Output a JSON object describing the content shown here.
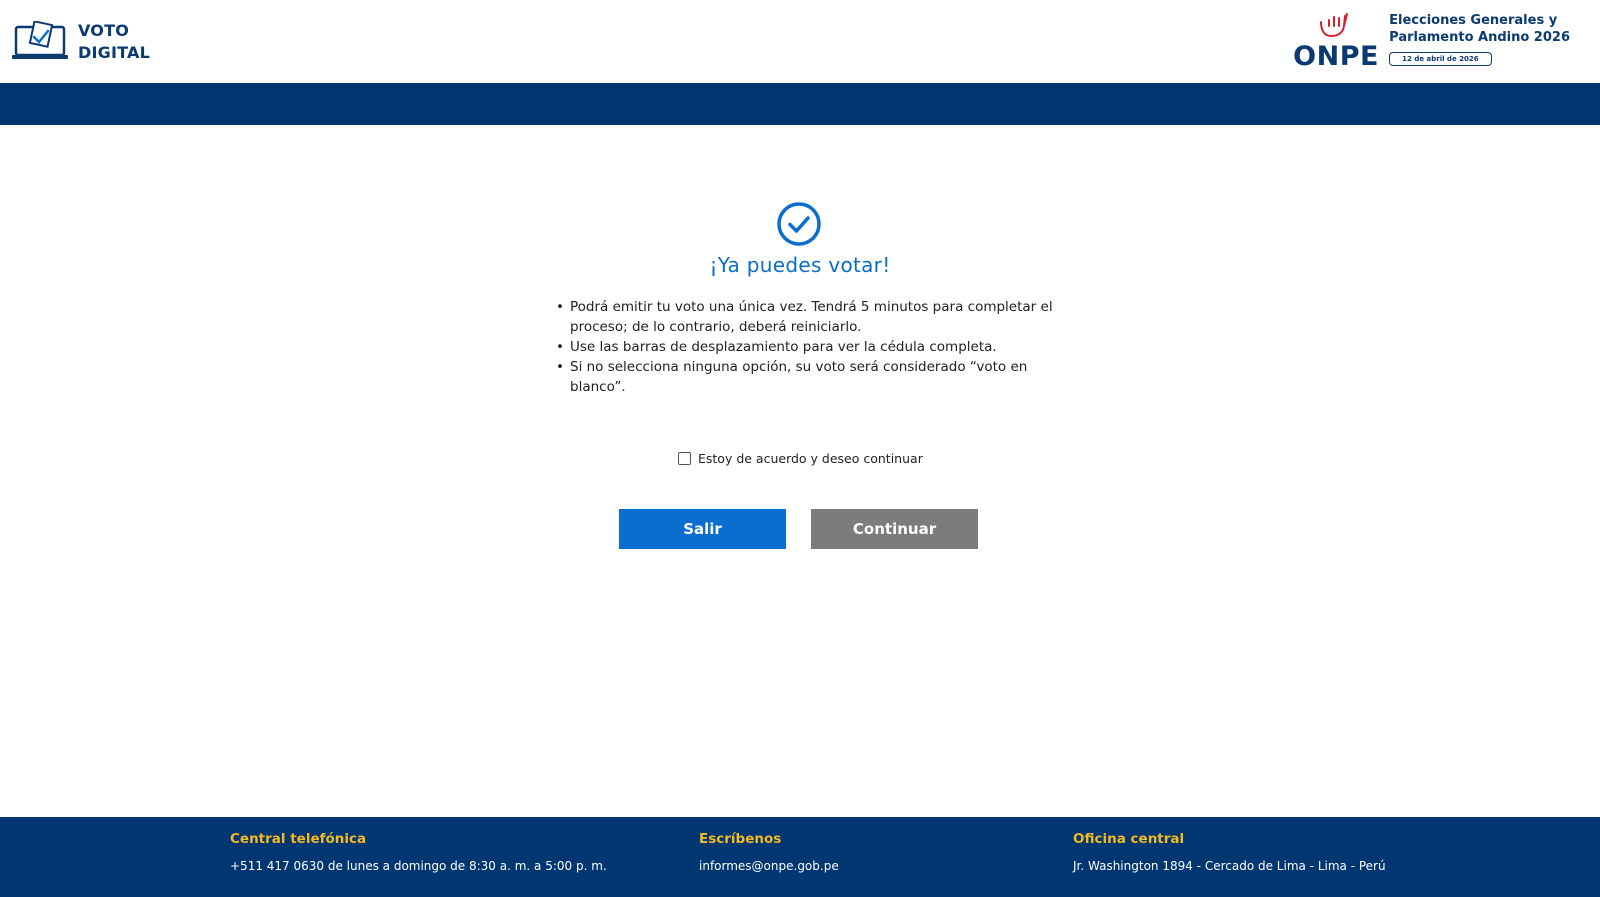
{
  "header": {
    "brand_line1": "VOTO",
    "brand_line2": "DIGITAL",
    "onpe": "ONPE",
    "election_line1": "Elecciones Generales y",
    "election_line2": "Parlamento Andino 2026",
    "election_date": "12 de abril de 2026"
  },
  "main": {
    "title": "¡Ya puedes votar!",
    "rules": [
      "Podrá emitir tu voto una única vez. Tendrá 5 minutos para completar el proceso; de lo contrario, deberá reiniciarlo.",
      "Use las barras de desplazamiento para ver la cédula completa.",
      "Si no selecciona ninguna opción, su voto será considerado “voto en blanco”."
    ],
    "agree_label": "Estoy de acuerdo y deseo continuar",
    "agree_checked": false,
    "exit_button": "Salir",
    "continue_button": "Continuar"
  },
  "footer": {
    "phone_heading": "Central telefónica",
    "phone_text": "+511 417 0630 de lunes a domingo de 8:30 a. m. a 5:00 p. m.",
    "write_heading": "Escríbenos",
    "write_text": "informes@onpe.gob.pe",
    "office_heading": "Oficina central",
    "office_text": "Jr. Washington 1894 - Cercado de Lima - Lima - Perú"
  },
  "colors": {
    "navy": "#003672",
    "primary_blue": "#0a6ed1",
    "disabled_gray": "#7c7c7c",
    "footer_heading": "#f5b921",
    "onpe_red": "#d5202f"
  },
  "icons": {
    "brand": "laptop-ballot-icon",
    "success": "check-circle-icon",
    "onpe_hand": "hand-icon",
    "checkbox": "checkbox-icon"
  }
}
